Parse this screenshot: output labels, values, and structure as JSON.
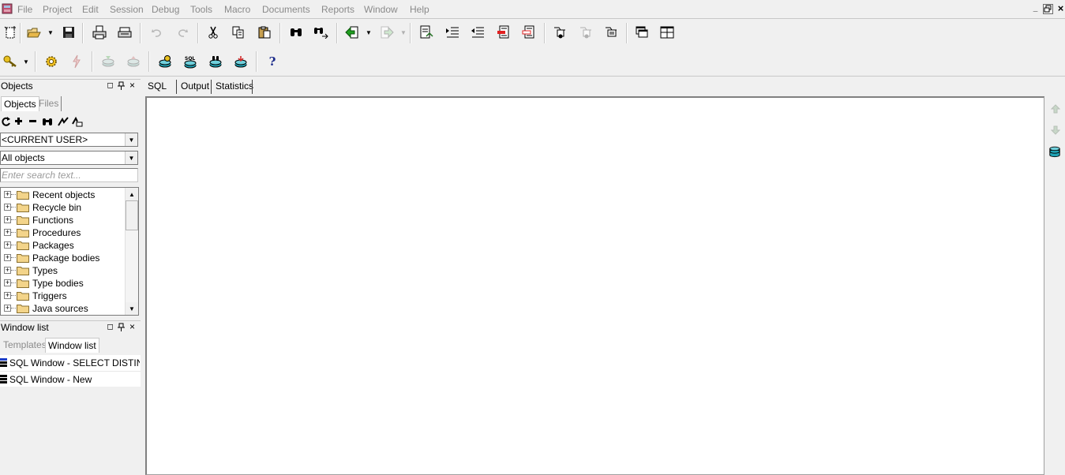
{
  "menu": {
    "items": [
      "File",
      "Project",
      "Edit",
      "Session",
      "Debug",
      "Tools",
      "Macro",
      "Documents",
      "Reports",
      "Window",
      "Help"
    ],
    "mdi_minimize": "_",
    "mdi_restore": "🗗",
    "mdi_close": "×"
  },
  "toolbar1": {
    "icons": [
      "new-icon",
      "open-icon",
      "open-dropdown-arrow",
      "save-icon",
      "print-icon",
      "print-preview-icon",
      "undo-icon",
      "redo-icon",
      "cut-icon",
      "copy-icon",
      "paste-icon",
      "find-icon",
      "find-next-icon",
      "back-icon",
      "back-dropdown-arrow",
      "forward-icon",
      "forward-dropdown-arrow",
      "report-icon",
      "indent-icon",
      "unindent-icon",
      "comment-icon",
      "uncomment-icon",
      "tool1-icon",
      "tool2-icon",
      "tool3-icon",
      "windows-icon",
      "tile-icon"
    ]
  },
  "toolbar2": {
    "icons": [
      "log-on-icon",
      "log-on-dropdown-arrow",
      "execute-icon",
      "break-icon",
      "commit-icon",
      "rollback-icon",
      "db-connect-icon",
      "sql-icon",
      "db-explain-icon",
      "db-refresh-icon",
      "help-icon"
    ],
    "help_label": "?",
    "sql_label": "SQL"
  },
  "objects_panel": {
    "title": "Objects",
    "tabs": [
      {
        "label": "Objects",
        "active": true
      },
      {
        "label": "Files",
        "active": false
      }
    ],
    "user_combo": "<CURRENT USER>",
    "filter_combo": "All objects",
    "search_placeholder": "Enter search text...",
    "tree_items": [
      "Recent objects",
      "Recycle bin",
      "Functions",
      "Procedures",
      "Packages",
      "Package bodies",
      "Types",
      "Type bodies",
      "Triggers",
      "Java sources"
    ],
    "expand_symbol": "+"
  },
  "window_list_panel": {
    "title": "Window list",
    "tabs": [
      {
        "label": "Templates",
        "active": false
      },
      {
        "label": "Window list",
        "active": true
      }
    ],
    "items": [
      "SQL Window - SELECT DISTINCT",
      "SQL Window - New"
    ]
  },
  "panel_buttons": {
    "float": "◻",
    "pin": "⊓",
    "close": "×"
  },
  "editor": {
    "tabs": [
      "SQL",
      "Output",
      "Statistics"
    ],
    "active_tab": "SQL"
  },
  "colors": {
    "background": "#f0f0f0",
    "folder": "#f3d48a",
    "disabled_text": "#8a8a8a",
    "db_teal": "#1fa3b5"
  }
}
